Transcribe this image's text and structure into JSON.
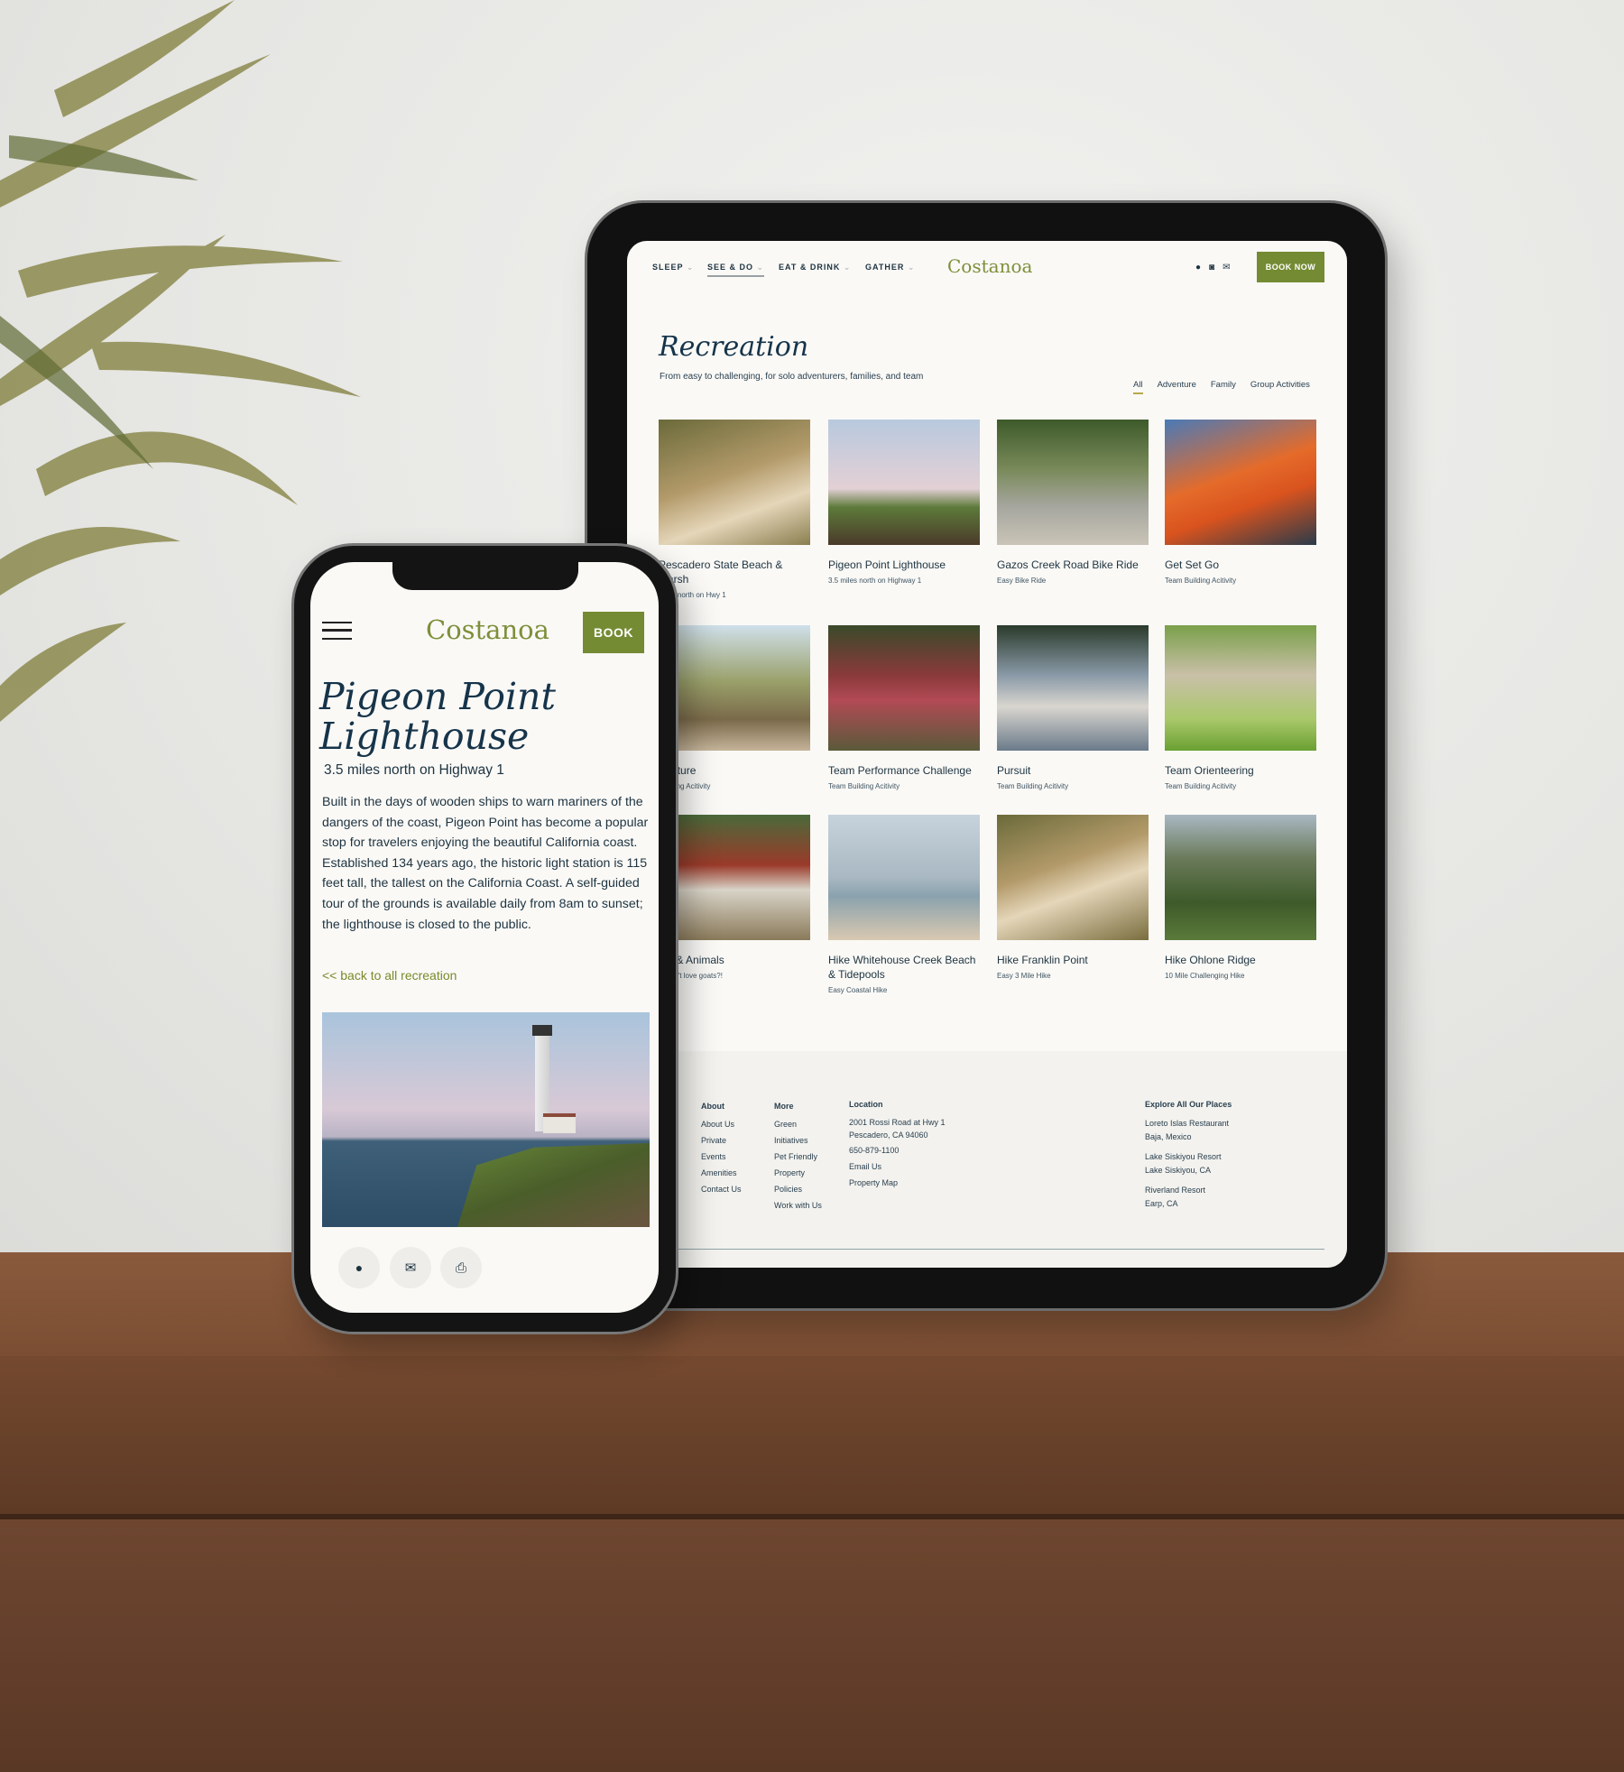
{
  "tablet": {
    "nav": [
      {
        "label": "SLEEP"
      },
      {
        "label": "SEE & DO"
      },
      {
        "label": "EAT & DRINK"
      },
      {
        "label": "GATHER"
      }
    ],
    "logo": "Costanoa",
    "social_icons": [
      "facebook-icon",
      "instagram-icon",
      "email-icon"
    ],
    "book_label": "BOOK NOW",
    "title": "Recreation",
    "subtitle": "From easy to challenging, for solo adventurers, families, and team",
    "filters": [
      {
        "label": "All",
        "active": true
      },
      {
        "label": "Adventure"
      },
      {
        "label": "Family"
      },
      {
        "label": "Group Activities"
      }
    ],
    "cards": [
      {
        "title": "Pescadero State Beach & Marsh",
        "subtitle": "miles north on Hwy 1"
      },
      {
        "title": "Pigeon Point Lighthouse",
        "subtitle": "3.5 miles north on Highway 1"
      },
      {
        "title": "Gazos Creek Road Bike Ride",
        "subtitle": "Easy Bike Ride"
      },
      {
        "title": "Get Set Go",
        "subtitle": "Team Building Acitivity"
      },
      {
        "title": "Venture",
        "subtitle": "Building Acitivity"
      },
      {
        "title": "Team Performance Challenge",
        "subtitle": "Team Building Acitivity"
      },
      {
        "title": "Pursuit",
        "subtitle": "Team Building Acitivity"
      },
      {
        "title": "Team Orienteering",
        "subtitle": "Team Building Acitivity"
      },
      {
        "title": "ats & Animals",
        "subtitle": "doesn't love goats?!"
      },
      {
        "title": "Hike Whitehouse Creek Beach & Tidepools",
        "subtitle": "Easy Coastal Hike"
      },
      {
        "title": "Hike Franklin Point",
        "subtitle": "Easy 3 Mile Hike"
      },
      {
        "title": "Hike Ohlone Ridge",
        "subtitle": "10 Mile Challenging Hike"
      }
    ],
    "footer": {
      "about": {
        "heading": "About",
        "items": [
          "About Us",
          "Private",
          "Events",
          "Amenities",
          "Contact Us"
        ]
      },
      "more": {
        "heading": "More",
        "items": [
          "Green",
          "Initiatives",
          "Pet Friendly",
          "Property",
          "Policies",
          "Work with Us"
        ]
      },
      "location": {
        "heading": "Location",
        "address1": "2001 Rossi Road at Hwy 1",
        "address2": "Pescadero, CA 94060",
        "phone": "650-879-1100",
        "items": [
          "Email Us",
          "Property Map"
        ]
      },
      "explore": {
        "heading": "Explore All Our Places",
        "places": [
          {
            "name": "Loreto Islas Restaurant",
            "loc": "Baja, Mexico"
          },
          {
            "name": "Lake Siskiyou Resort",
            "loc": "Lake Siskiyou, CA"
          },
          {
            "name": "Riverland Resort",
            "loc": "Earp, CA"
          }
        ]
      }
    }
  },
  "phone": {
    "logo": "Costanoa",
    "book_label": "BOOK",
    "title_line1": "Pigeon Point",
    "title_line2": "Lighthouse",
    "subtitle": "3.5 miles north on Highway 1",
    "body": "Built in the days of wooden ships to warn mariners of the dangers of the coast, Pigeon Point has become a popular stop for travelers enjoying the beautiful California coast. Established 134 years ago, the historic light station is 115 feet tall, the tallest on the California Coast. A self-guided tour of the grounds is available daily from 8am to sunset; the lighthouse is closed to the public.",
    "back_link": "<< back to all recreation",
    "share_icons": [
      "facebook-icon",
      "email-icon",
      "print-icon"
    ]
  },
  "colors": {
    "accent": "#748b33",
    "text": "#1d3340",
    "background": "#faf9f6"
  }
}
